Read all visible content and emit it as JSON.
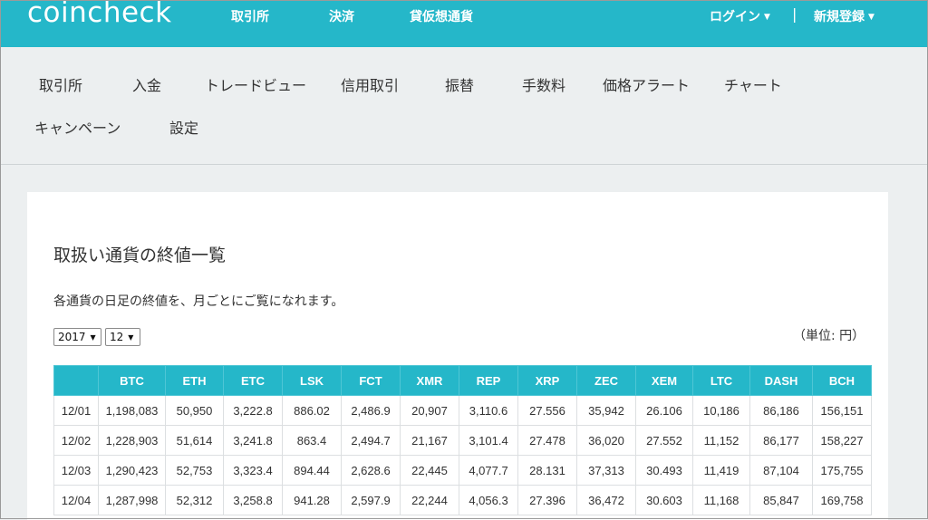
{
  "header": {
    "logo": "coincheck",
    "nav": [
      "取引所",
      "決済",
      "貸仮想通貨"
    ],
    "login": "ログイン",
    "separator": "|",
    "signup": "新規登録"
  },
  "subnav": {
    "row1": [
      "取引所",
      "入金",
      "トレードビュー",
      "信用取引",
      "振替",
      "手数料",
      "価格アラート",
      "チャート"
    ],
    "row2": [
      "キャンペーン",
      "設定"
    ]
  },
  "main": {
    "title": "取扱い通貨の終値一覧",
    "description": "各通貨の日足の終値を、月ごとにご覧になれます。",
    "year_select": "2017",
    "month_select": "12",
    "unit": "（単位: 円）"
  },
  "table": {
    "headers": [
      "",
      "BTC",
      "ETH",
      "ETC",
      "LSK",
      "FCT",
      "XMR",
      "REP",
      "XRP",
      "ZEC",
      "XEM",
      "LTC",
      "DASH",
      "BCH"
    ],
    "rows": [
      [
        "12/01",
        "1,198,083",
        "50,950",
        "3,222.8",
        "886.02",
        "2,486.9",
        "20,907",
        "3,110.6",
        "27.556",
        "35,942",
        "26.106",
        "10,186",
        "86,186",
        "156,151"
      ],
      [
        "12/02",
        "1,228,903",
        "51,614",
        "3,241.8",
        "863.4",
        "2,494.7",
        "21,167",
        "3,101.4",
        "27.478",
        "36,020",
        "27.552",
        "11,152",
        "86,177",
        "158,227"
      ],
      [
        "12/03",
        "1,290,423",
        "52,753",
        "3,323.4",
        "894.44",
        "2,628.6",
        "22,445",
        "4,077.7",
        "28.131",
        "37,313",
        "30.493",
        "11,419",
        "87,104",
        "175,755"
      ],
      [
        "12/04",
        "1,287,998",
        "52,312",
        "3,258.8",
        "941.28",
        "2,597.9",
        "22,244",
        "4,056.3",
        "27.396",
        "36,472",
        "30.603",
        "11,168",
        "85,847",
        "169,758"
      ]
    ]
  },
  "colors": {
    "accent": "#25b7c9",
    "background": "#eceff0",
    "card": "#ffffff"
  }
}
